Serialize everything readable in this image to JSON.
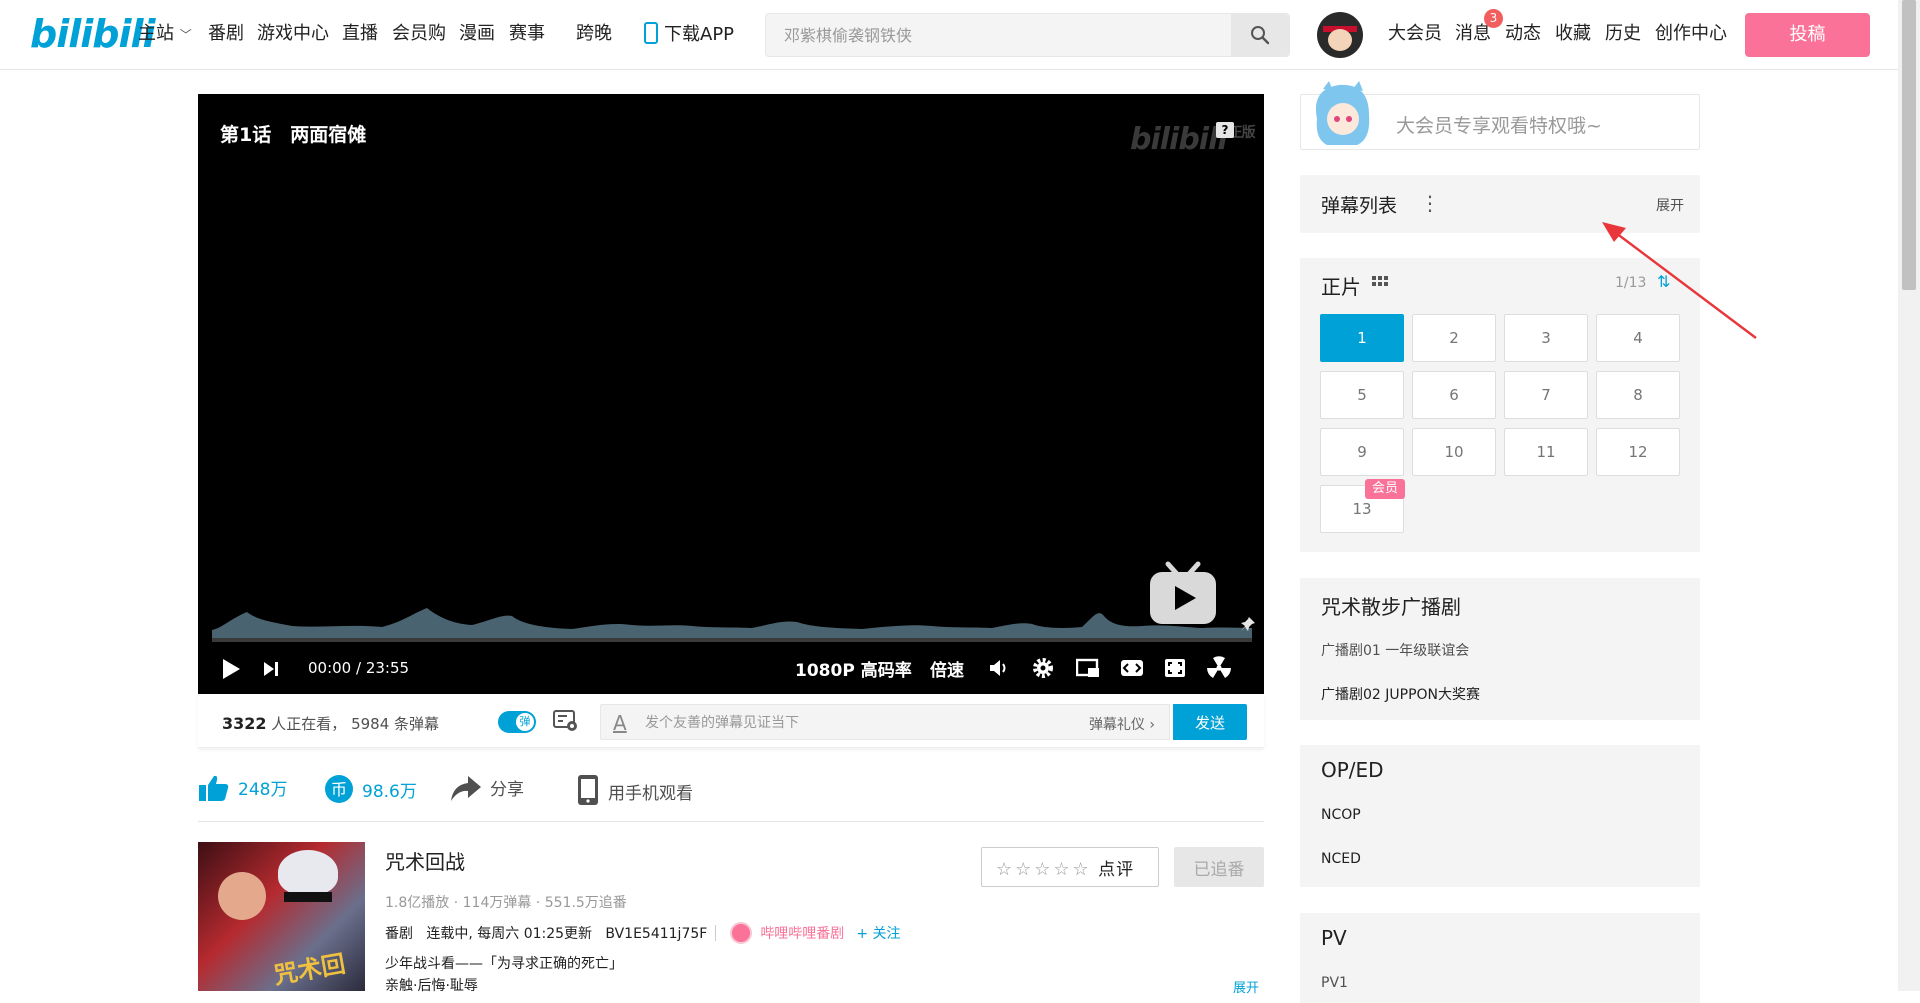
{
  "header": {
    "logo": "bilibili",
    "nav": [
      "主站",
      "番剧",
      "游戏中心",
      "直播",
      "会员购",
      "漫画",
      "赛事",
      "跨晚"
    ],
    "download_app": "下载APP",
    "search_placeholder": "邓紫棋偷袭钢铁侠",
    "right_nav": [
      "大会员",
      "消息",
      "动态",
      "收藏",
      "历史",
      "创作中心"
    ],
    "message_badge": "3",
    "upload": "投稿"
  },
  "player": {
    "episode_title": "第1话　两面宿傩",
    "watermark": "bilibili",
    "watermark_suffix": "正版",
    "help": "?",
    "time_current": "00:00",
    "time_total": "23:55",
    "quality": "1080P 高码率",
    "speed": "倍速"
  },
  "danmaku_bar": {
    "viewers_count": "3322",
    "viewers_text": " 人正在看，",
    "danmaku_count": "5984 条弹幕",
    "toggle_label": "弹",
    "input_placeholder": "发个友善的弹幕见证当下",
    "etiquette": "弹幕礼仪 ›",
    "send": "发送"
  },
  "actions": {
    "likes": "248万",
    "coins": "98.6万",
    "share": "分享",
    "mobile": "用手机观看"
  },
  "anime": {
    "title": "咒术回战",
    "rate_label": "点评",
    "followed_label": "已追番",
    "plays": "1.8亿播放",
    "danmaku": "114万弹幕",
    "follows": "551.5万追番",
    "category": "番剧",
    "update": "连载中, 每周六 01:25更新",
    "bvid": "BV1E5411j75F",
    "uploader": "哔哩哔哩番剧",
    "follow_uploader": "+ 关注",
    "tagline": "少年战斗看——「为寻求正确的死亡」",
    "genre": "亲触·后悔·耻辱",
    "expand": "展开",
    "cover_text": "咒术回战"
  },
  "sidebar": {
    "vip_banner": "大会员专享观看特权哦~",
    "danmaku_list": "弹幕列表",
    "danmaku_expand": "展开",
    "episodes_title": "正片",
    "episodes_count": "1/13",
    "episodes": [
      "1",
      "2",
      "3",
      "4",
      "5",
      "6",
      "7",
      "8",
      "9",
      "10",
      "11",
      "12",
      "13"
    ],
    "vip_tag": "会员",
    "radio_title": "咒术散步广播剧",
    "radio_items": [
      "广播剧01 一年级联谊会",
      "广播剧02 JUPPON大奖赛"
    ],
    "oped_title": "OP/ED",
    "oped_items": [
      "NCOP",
      "NCED"
    ],
    "pv_title": "PV",
    "pv_items": [
      "PV1"
    ]
  },
  "colors": {
    "brand_blue": "#00a1d6",
    "brand_pink": "#fb7299",
    "annotation_red": "#e8363a"
  }
}
